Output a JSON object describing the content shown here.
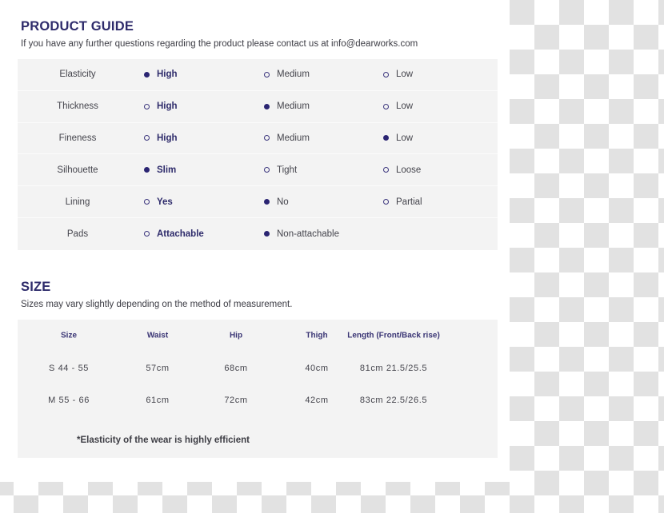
{
  "product_guide": {
    "title": "PRODUCT GUIDE",
    "subtitle": "If you have any further questions regarding the product please contact us at info@dearworks.com",
    "rows": [
      {
        "label": "Elasticity",
        "options": [
          {
            "text": "High",
            "selected": true
          },
          {
            "text": "Medium",
            "selected": false
          },
          {
            "text": "Low",
            "selected": false
          }
        ]
      },
      {
        "label": "Thickness",
        "options": [
          {
            "text": "High",
            "selected": false
          },
          {
            "text": "Medium",
            "selected": true
          },
          {
            "text": "Low",
            "selected": false
          }
        ]
      },
      {
        "label": "Fineness",
        "options": [
          {
            "text": "High",
            "selected": false
          },
          {
            "text": "Medium",
            "selected": false
          },
          {
            "text": "Low",
            "selected": true
          }
        ]
      },
      {
        "label": "Silhouette",
        "options": [
          {
            "text": "Slim",
            "selected": true
          },
          {
            "text": "Tight",
            "selected": false
          },
          {
            "text": "Loose",
            "selected": false
          }
        ]
      },
      {
        "label": "Lining",
        "options": [
          {
            "text": "Yes",
            "selected": false
          },
          {
            "text": "No",
            "selected": true
          },
          {
            "text": "Partial",
            "selected": false
          }
        ]
      },
      {
        "label": "Pads",
        "options": [
          {
            "text": "Attachable",
            "selected": false
          },
          {
            "text": "Non-attachable",
            "selected": true
          }
        ]
      }
    ]
  },
  "size": {
    "title": "SIZE",
    "subtitle": "Sizes may vary slightly depending on the method of measurement.",
    "columns": [
      "Size",
      "Waist",
      "Hip",
      "Thigh",
      "Length (Front/Back rise)"
    ],
    "rows": [
      [
        "S  44  -  55",
        "57cm",
        "68cm",
        "40cm",
        "81cm   21.5/25.5"
      ],
      [
        "M  55  -  66",
        "61cm",
        "72cm",
        "42cm",
        "83cm   22.5/26.5"
      ]
    ],
    "note": "*Elasticity of the wear is highly efficient"
  },
  "colors": {
    "accent": "#2e2b6b",
    "radio_selected": "#2b2572",
    "panel_bg": "#f3f3f3",
    "text": "#44444c"
  }
}
